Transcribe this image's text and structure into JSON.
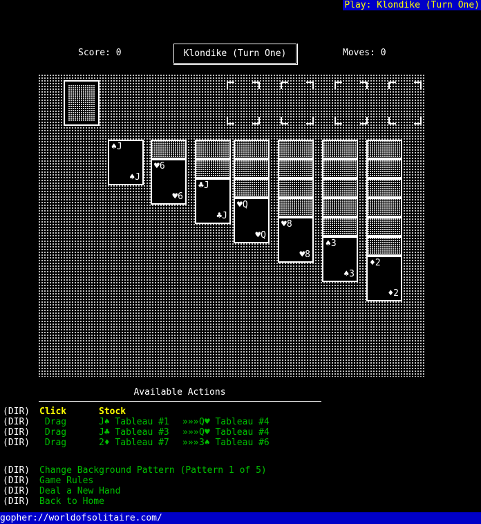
{
  "titlebar": {
    "text": "Play: Klondike (Turn One)",
    "bg": "#0000c8",
    "fg": "#ffff00"
  },
  "header": {
    "score_label": "Score: 0",
    "moves_label": "Moves: 0",
    "game_name": "Klondike (Turn One)"
  },
  "board": {
    "stock": {
      "label": "Stock",
      "facedown": true
    },
    "waste": {
      "empty": true
    },
    "foundations": [
      {
        "name": "foundation-1",
        "empty": true
      },
      {
        "name": "foundation-2",
        "empty": true
      },
      {
        "name": "foundation-3",
        "empty": true
      },
      {
        "name": "foundation-4",
        "empty": true
      }
    ],
    "tableau": [
      {
        "column": 1,
        "facedown": 0,
        "faceup": [
          {
            "rank": "J",
            "suit": "♠",
            "tl": "♠J",
            "br": "♠J"
          }
        ]
      },
      {
        "column": 2,
        "facedown": 1,
        "faceup": [
          {
            "rank": "6",
            "suit": "♥",
            "tl": "♥6",
            "br": "♥6"
          }
        ]
      },
      {
        "column": 3,
        "facedown": 2,
        "faceup": [
          {
            "rank": "J",
            "suit": "♣",
            "tl": "♣J",
            "br": "♣J"
          }
        ]
      },
      {
        "column": 4,
        "facedown": 3,
        "faceup": [
          {
            "rank": "Q",
            "suit": "♥",
            "tl": "♥Q",
            "br": "♥Q"
          }
        ]
      },
      {
        "column": 5,
        "facedown": 4,
        "faceup": [
          {
            "rank": "8",
            "suit": "♥",
            "tl": "♥8",
            "br": "♥8"
          }
        ]
      },
      {
        "column": 6,
        "facedown": 5,
        "faceup": [
          {
            "rank": "3",
            "suit": "♠",
            "tl": "♠3",
            "br": "♠3"
          }
        ]
      },
      {
        "column": 7,
        "facedown": 6,
        "faceup": [
          {
            "rank": "2",
            "suit": "♦",
            "tl": "♦2",
            "br": "♦2"
          }
        ]
      }
    ]
  },
  "actions": {
    "title": "Available Actions",
    "rows": [
      {
        "dir": "(DIR)",
        "verb": "Click",
        "verb_color": "yellow",
        "source": "Stock",
        "source_color": "yellow",
        "arrow": "",
        "target": ""
      },
      {
        "dir": "(DIR)",
        "verb": " Drag",
        "verb_color": "green",
        "source": "J♠ Tableau #1",
        "source_color": "green",
        "arrow": "»»»",
        "target": "Q♥ Tableau #4"
      },
      {
        "dir": "(DIR)",
        "verb": " Drag",
        "verb_color": "green",
        "source": "J♣ Tableau #3",
        "source_color": "green",
        "arrow": "»»»",
        "target": "Q♥ Tableau #4"
      },
      {
        "dir": "(DIR)",
        "verb": " Drag",
        "verb_color": "green",
        "source": "2♦ Tableau #7",
        "source_color": "green",
        "arrow": "»»»",
        "target": "3♠ Tableau #6"
      }
    ]
  },
  "menu": {
    "items": [
      {
        "dir": "(DIR)",
        "label": "Change Background Pattern (Pattern 1 of 5)"
      },
      {
        "dir": "(DIR)",
        "label": "Game Rules"
      },
      {
        "dir": "(DIR)",
        "label": "Deal a New Hand"
      },
      {
        "dir": "(DIR)",
        "label": "Back to Home"
      }
    ]
  },
  "statusbar": {
    "url": "gopher://worldofsolitaire.com/"
  }
}
